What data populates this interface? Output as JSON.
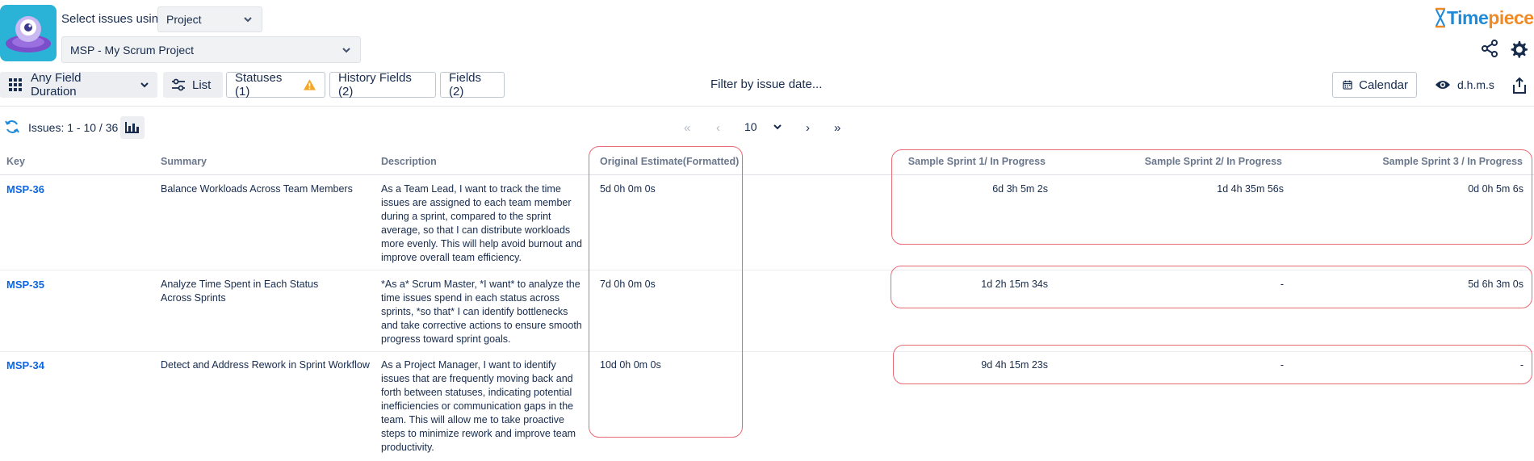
{
  "header": {
    "select_label": "Select issues using",
    "select_type_value": "Project",
    "project_value": "MSP - My Scrum Project",
    "brand": {
      "part1": "Time",
      "part2": "piece"
    }
  },
  "toolbar": {
    "duration_label": "Any Field Duration",
    "list_label": "List",
    "statuses_label": "Statuses (1)",
    "history_label": "History Fields (2)",
    "fields_label": "Fields (2)",
    "filter_label": "Filter by issue date...",
    "calendar_label": "Calendar",
    "format_label": "d.h.m.s"
  },
  "issues_bar": {
    "count_label": "Issues: 1 - 10 / 36",
    "page_size": "10"
  },
  "table": {
    "columns": {
      "key": "Key",
      "summary": "Summary",
      "description": "Description",
      "estimate": "Original Estimate(Formatted)",
      "sprint1": "Sample Sprint 1/ In Progress",
      "sprint2": "Sample Sprint 2/ In Progress",
      "sprint3": "Sample Sprint 3 / In Progress"
    },
    "rows": [
      {
        "key": "MSP-36",
        "summary": "Balance Workloads Across Team Members",
        "description": "As a Team Lead, I want to track the time issues are assigned to each team member during a sprint, compared to the sprint average, so that I can distribute workloads more evenly. This will help avoid burnout and improve overall team efficiency.",
        "estimate": "5d 0h 0m 0s",
        "sprint1": "6d 3h 5m 2s",
        "sprint2": "1d 4h 35m 56s",
        "sprint3": "0d 0h 5m 6s"
      },
      {
        "key": "MSP-35",
        "summary": "Analyze Time Spent in Each Status Across Sprints",
        "description": "*As a* Scrum Master, *I want* to analyze the time issues spend in each status across sprints, *so that* I can identify bottlenecks and take corrective actions to ensure smooth progress toward sprint goals.",
        "estimate": "7d 0h 0m 0s",
        "sprint1": "1d 2h 15m 34s",
        "sprint2": "-",
        "sprint3": "5d 6h 3m 0s"
      },
      {
        "key": "MSP-34",
        "summary": "Detect and Address Rework in Sprint Workflow",
        "description": "As a Project Manager, I want to identify issues that are frequently moving back and forth between statuses, indicating potential inefficiencies or communication gaps in the team. This will allow me to take proactive steps to minimize rework and improve team productivity.",
        "estimate": "10d 0h 0m 0s",
        "sprint1": "9d 4h 15m 23s",
        "sprint2": "-",
        "sprint3": "-"
      }
    ]
  },
  "colors": {
    "accent": "#0c66e4",
    "highlight": "#e86a74",
    "warning": "#f5a623"
  }
}
